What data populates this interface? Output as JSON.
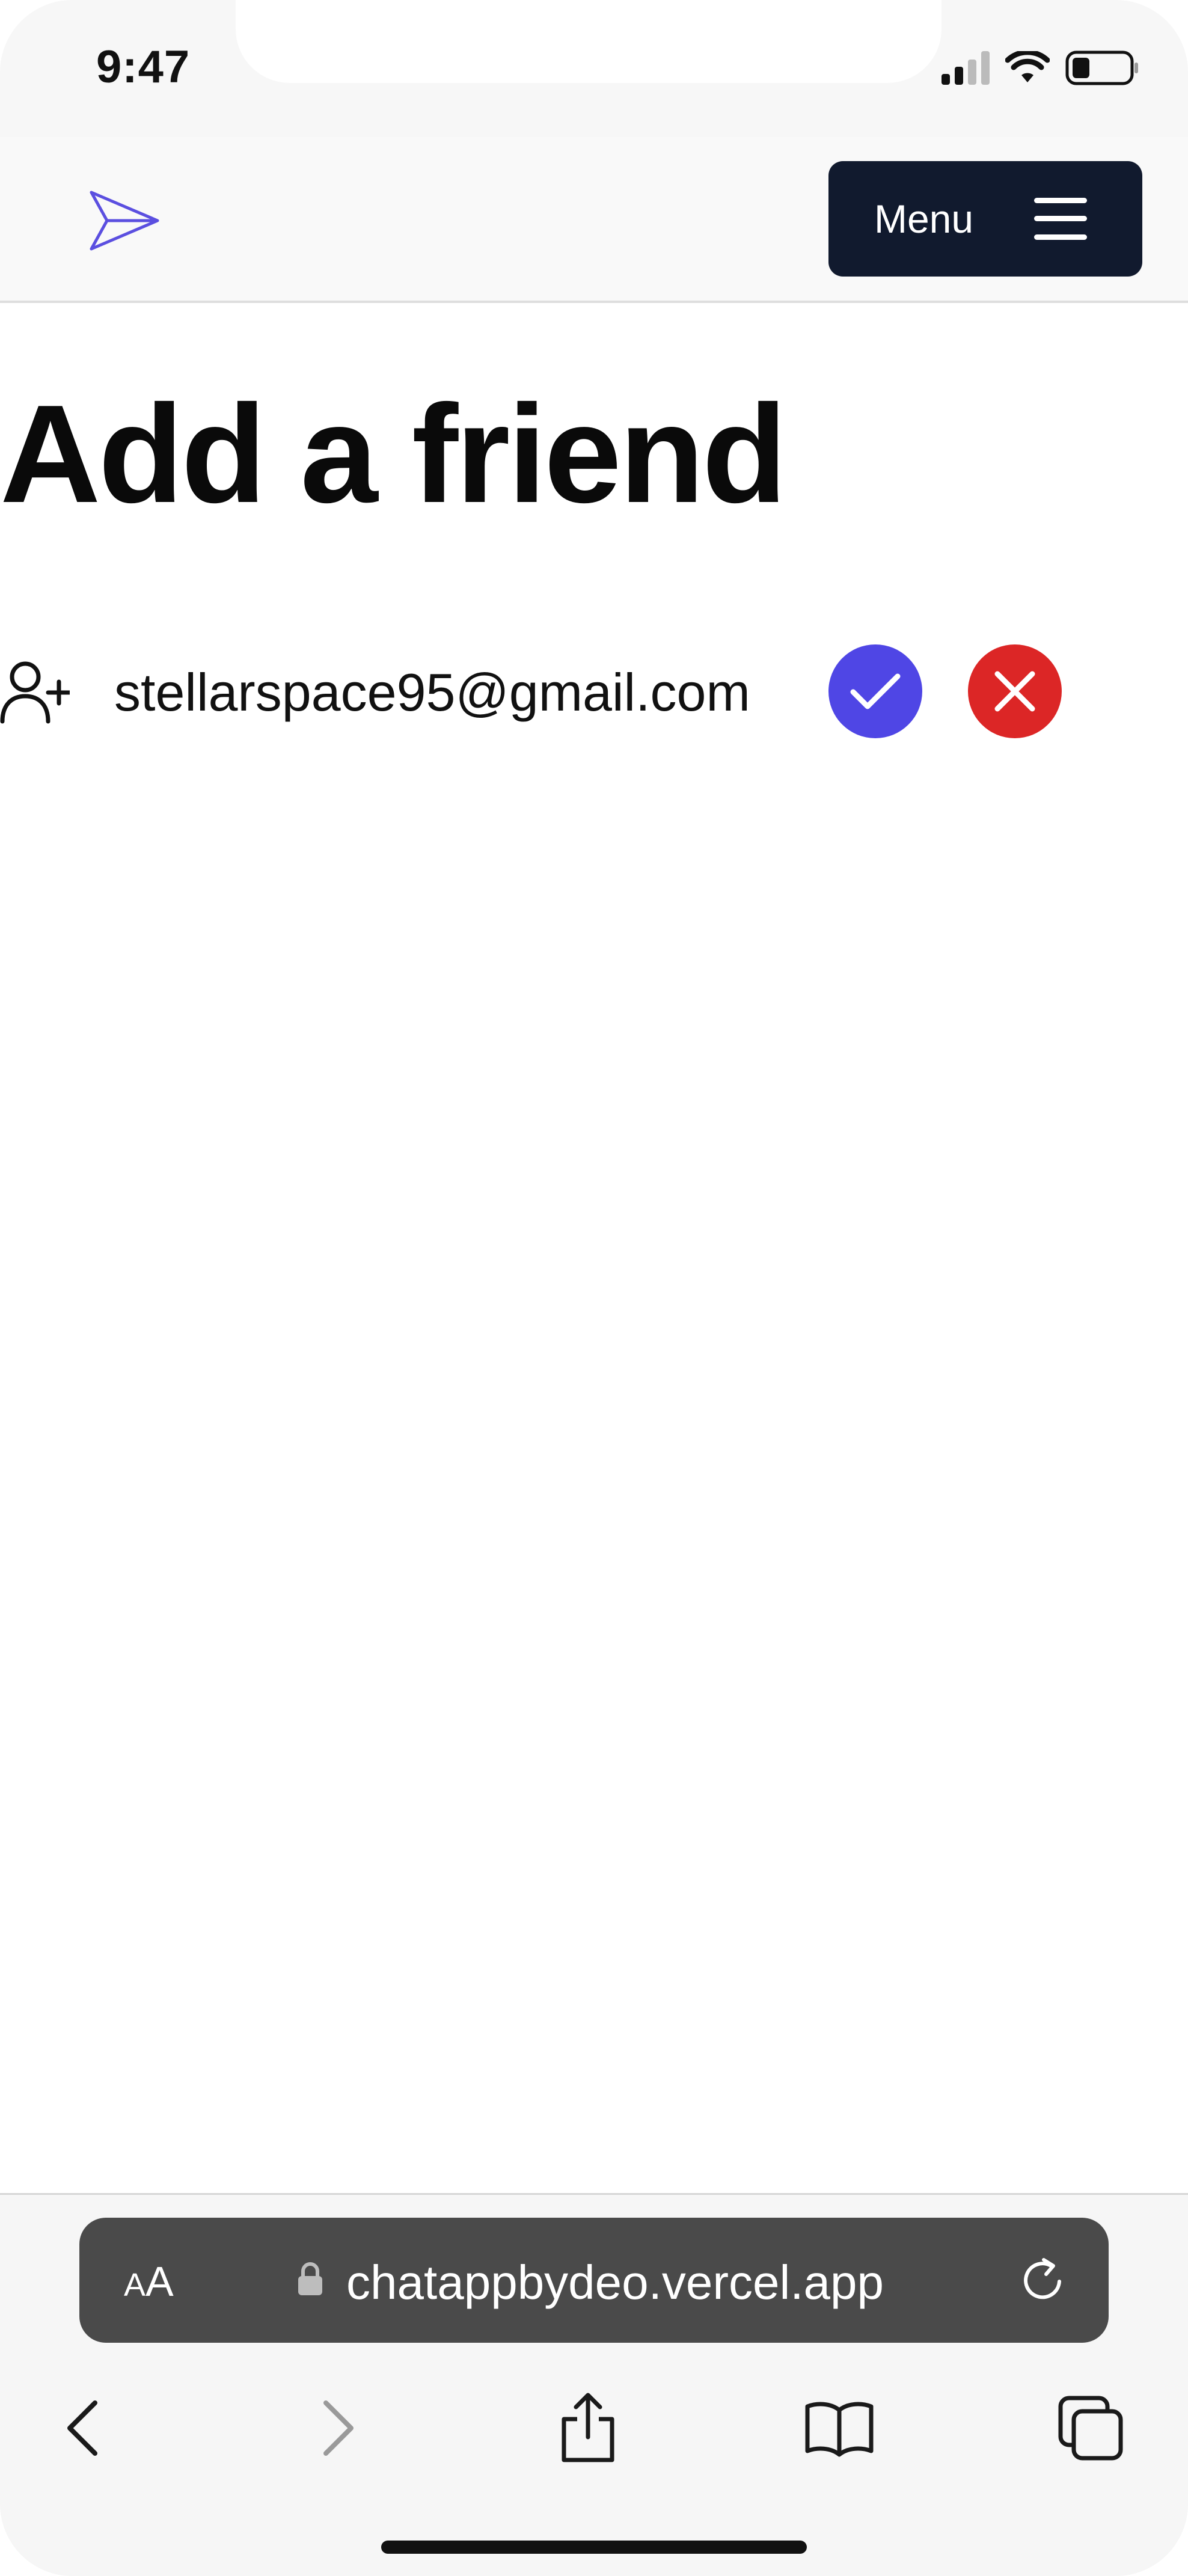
{
  "status_bar": {
    "time": "9:47",
    "icons": [
      "signal-icon",
      "wifi-icon",
      "battery-icon"
    ]
  },
  "navbar": {
    "logo_icon": "paper-plane-icon",
    "menu_label": "Menu",
    "menu_icon": "hamburger-icon"
  },
  "main": {
    "title": "Add a friend",
    "requests": [
      {
        "icon": "user-plus-icon",
        "email": "stellarspace95@gmail.com",
        "accept_icon": "check-icon",
        "deny_icon": "close-icon"
      }
    ]
  },
  "browser": {
    "text_size_label_small": "A",
    "text_size_label_large": "A",
    "url": "chatappbydeo.vercel.app",
    "toolbar": [
      "back-icon",
      "forward-icon",
      "share-icon",
      "bookmarks-icon",
      "tabs-icon"
    ]
  },
  "colors": {
    "accent": "#4f46e5",
    "danger": "#dc2626",
    "menu_bg": "#111a2e",
    "url_bar_bg": "#4a4a4a"
  }
}
